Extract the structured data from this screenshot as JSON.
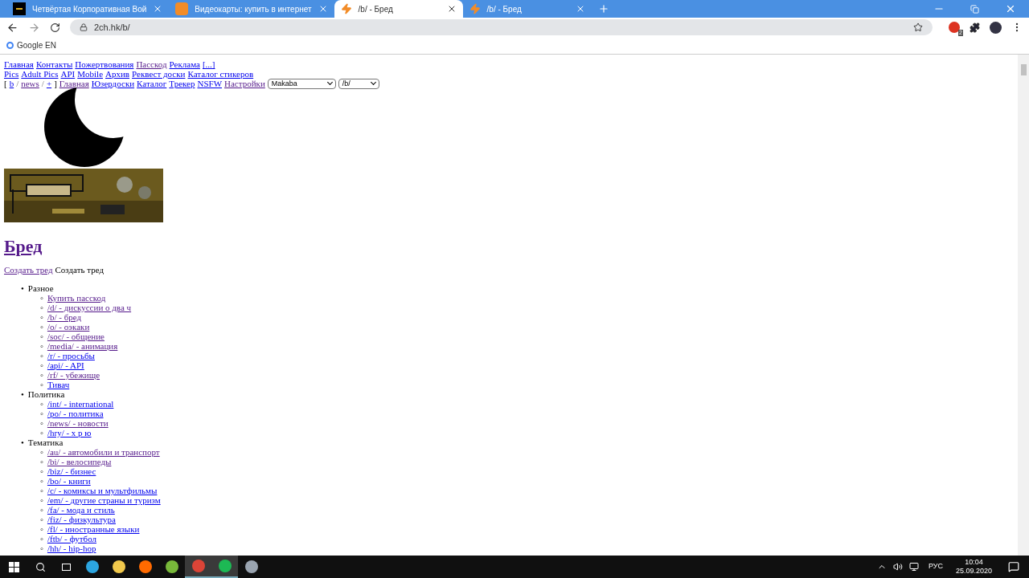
{
  "browser": {
    "tabs": [
      {
        "title": "Четвёртая Корпоративная Вой",
        "kind": "game",
        "selected": false
      },
      {
        "title": "Видеокарты: купить в интернет",
        "kind": "dns",
        "selected": false
      },
      {
        "title": "/b/ - Бред",
        "kind": "bolt",
        "selected": true
      },
      {
        "title": "/b/ - Бред",
        "kind": "bolt",
        "selected": false
      }
    ],
    "address": "2ch.hk/b/",
    "extension_badge": "2",
    "bookmarks": [
      "Google EN"
    ]
  },
  "page": {
    "nav_rows": [
      [
        {
          "text": "Главная",
          "visited": false
        },
        {
          "text": "Контакты",
          "visited": false
        },
        {
          "text": "Пожертвования",
          "visited": false
        },
        {
          "text": "Пасскод",
          "visited": true
        },
        {
          "text": "Реклама",
          "visited": false
        },
        {
          "text": "[...]",
          "visited": false
        }
      ],
      [
        {
          "text": "Pics",
          "visited": false
        },
        {
          "text": "Adult Pics",
          "visited": false
        },
        {
          "text": "API",
          "visited": false
        },
        {
          "text": "Mobile",
          "visited": false
        },
        {
          "text": "Архив",
          "visited": false
        },
        {
          "text": "Реквест доски",
          "visited": false
        },
        {
          "text": "Каталог стикеров",
          "visited": false
        }
      ]
    ],
    "board_row": [
      {
        "kind": "text",
        "text": "["
      },
      {
        "kind": "link",
        "text": "b",
        "visited": false
      },
      {
        "kind": "sep",
        "text": "/"
      },
      {
        "kind": "link",
        "text": "news",
        "visited": true
      },
      {
        "kind": "sep",
        "text": "/"
      },
      {
        "kind": "link",
        "text": "+",
        "visited": false
      },
      {
        "kind": "text",
        "text": "]"
      },
      {
        "kind": "link",
        "text": "Главная",
        "visited": true
      },
      {
        "kind": "link",
        "text": "Юзердоски",
        "visited": false
      },
      {
        "kind": "link",
        "text": "Каталог",
        "visited": false
      },
      {
        "kind": "link",
        "text": "Трекер",
        "visited": false
      },
      {
        "kind": "link",
        "text": "NSFW",
        "visited": false
      },
      {
        "kind": "link",
        "text": "Настройки",
        "visited": true
      }
    ],
    "selects": [
      "Makaba",
      "/b/"
    ],
    "banner": {
      "kind": "picture"
    },
    "title": {
      "text": "Бред",
      "visited": true
    },
    "create_link": {
      "text": "Создать тред",
      "visited": true
    },
    "create_text": "Создать тред",
    "sections": [
      {
        "name": "Разное",
        "marker": "•",
        "item_marker": "◦",
        "items": [
          {
            "text": "Купить пасскод",
            "visited": true
          },
          {
            "text": "/d/ - дискуссии о два ч",
            "visited": true
          },
          {
            "text": "/b/ - бред",
            "visited": true
          },
          {
            "text": "/o/ - оэкаки",
            "visited": true
          },
          {
            "text": "/soc/ - общение",
            "visited": true
          },
          {
            "text": "/media/ - анимация",
            "visited": true
          },
          {
            "text": "/r/ - просьбы",
            "visited": false
          },
          {
            "text": "/api/ - API",
            "visited": false
          },
          {
            "text": "/rf/ - убежище",
            "visited": true
          },
          {
            "text": "Тивач",
            "visited": false
          }
        ]
      },
      {
        "name": "Политика",
        "marker": "•",
        "item_marker": "◦",
        "items": [
          {
            "text": "/int/ - international",
            "visited": false
          },
          {
            "text": "/po/ - политика",
            "visited": false
          },
          {
            "text": "/news/ - новости",
            "visited": true
          },
          {
            "text": "/hry/ - х р ю",
            "visited": false
          }
        ]
      },
      {
        "name": "Тематика",
        "marker": "•",
        "item_marker": "◦",
        "items": [
          {
            "text": "/au/ - автомобили и транспорт",
            "visited": true
          },
          {
            "text": "/bi/ - велосипеды",
            "visited": true
          },
          {
            "text": "/biz/ - бизнес",
            "visited": false
          },
          {
            "text": "/bo/ - книги",
            "visited": false
          },
          {
            "text": "/c/ - комиксы и мультфильмы",
            "visited": false
          },
          {
            "text": "/em/ - другие страны и туризм",
            "visited": false
          },
          {
            "text": "/fa/ - мода и стиль",
            "visited": false
          },
          {
            "text": "/fiz/ - физкультура",
            "visited": false
          },
          {
            "text": "/fl/ - иностранные языки",
            "visited": false
          },
          {
            "text": "/ftb/ - футбол",
            "visited": false
          },
          {
            "text": "/hh/ - hip-hop",
            "visited": false
          }
        ]
      }
    ]
  },
  "taskbar": {
    "apps": [
      {
        "color": "#2ca5e0",
        "active": false
      },
      {
        "color": "#f2c94c",
        "active": false
      },
      {
        "color": "#ff6a00",
        "active": false
      },
      {
        "color": "#78b83a",
        "active": false
      },
      {
        "color": "#db4437",
        "active": true
      },
      {
        "color": "#1db954",
        "active": true
      },
      {
        "color": "#9aa4b0",
        "active": false
      }
    ],
    "language": "РУС",
    "time": "10:04",
    "date": "25.09.2020"
  }
}
